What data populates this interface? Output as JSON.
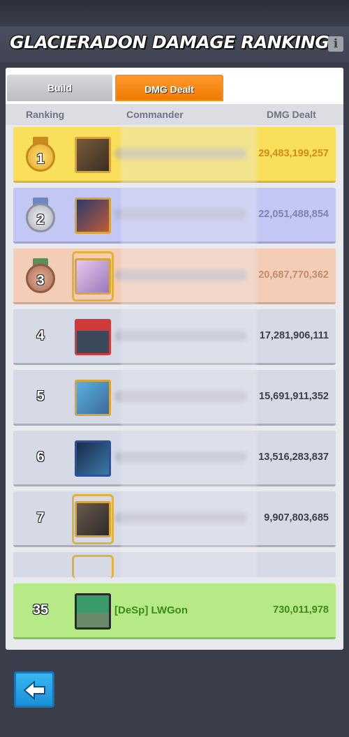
{
  "header": {
    "title": "GLACIERADON DAMAGE RANKING",
    "info_label": "i"
  },
  "tabs": [
    {
      "label": "Build",
      "active": false
    },
    {
      "label": "DMG Dealt",
      "active": true
    }
  ],
  "columns": {
    "ranking": "Ranking",
    "commander": "Commander",
    "dmg": "DMG Dealt"
  },
  "rows": [
    {
      "rank": "1",
      "dmg": "29,483,199,257",
      "tier": "gold"
    },
    {
      "rank": "2",
      "dmg": "22,051,488,854",
      "tier": "silver"
    },
    {
      "rank": "3",
      "dmg": "20,687,770,362",
      "tier": "bronze"
    },
    {
      "rank": "4",
      "dmg": "17,281,906,111",
      "tier": "plain"
    },
    {
      "rank": "5",
      "dmg": "15,691,911,352",
      "tier": "plain"
    },
    {
      "rank": "6",
      "dmg": "13,516,283,837",
      "tier": "plain"
    },
    {
      "rank": "7",
      "dmg": "9,907,803,685",
      "tier": "plain"
    }
  ],
  "my_row": {
    "rank": "35",
    "name": "[DeSp] LWGon",
    "dmg": "730,011,978"
  },
  "colors": {
    "accent": "#f07a00",
    "gold": "#f9df5a",
    "silver": "#c2c7f4",
    "bronze": "#f4cdb7",
    "mine": "#b6ea86"
  },
  "icons": {
    "back": "back-arrow-icon",
    "info": "info-icon"
  }
}
